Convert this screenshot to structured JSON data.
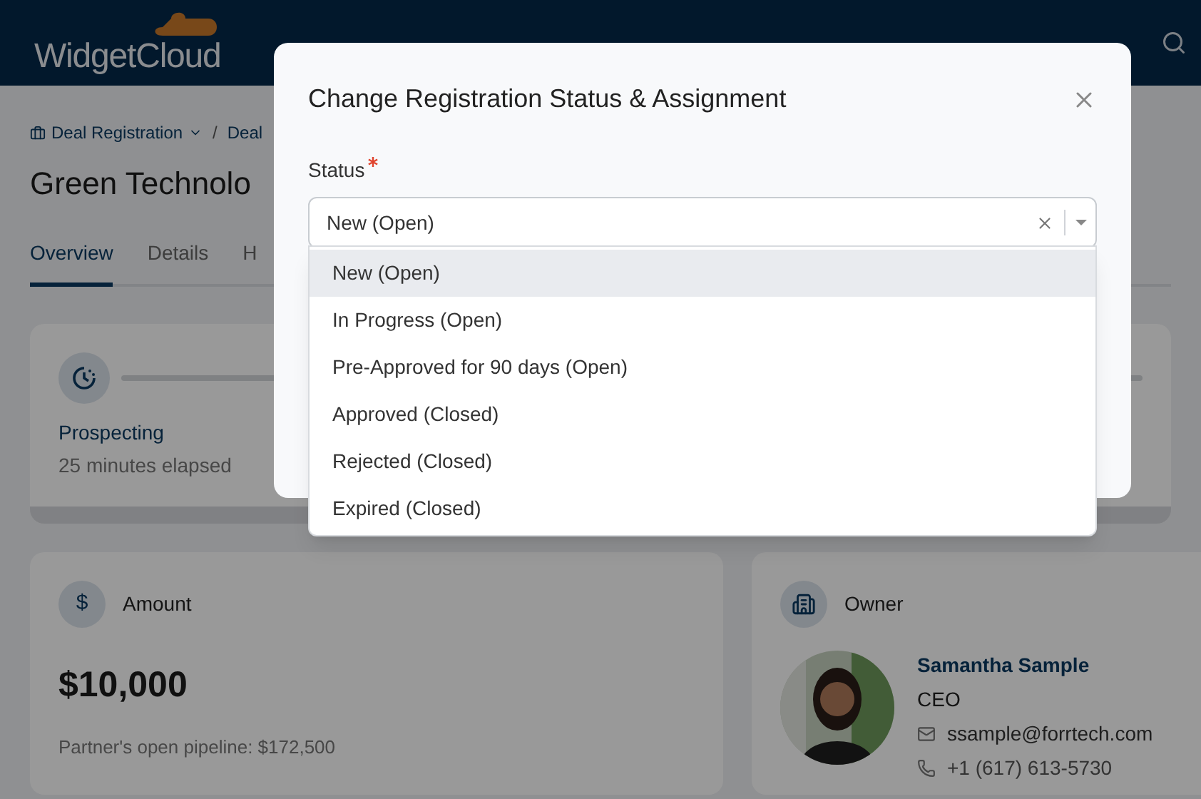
{
  "header": {
    "logo": "WidgetCloud"
  },
  "breadcrumb": {
    "items": [
      "Deal Registration",
      "Deal"
    ],
    "separator": "/"
  },
  "page_title": "Green Technolo",
  "tabs": [
    {
      "label": "Overview",
      "selected": true
    },
    {
      "label": "Details",
      "selected": false
    },
    {
      "label": "H",
      "selected": false
    }
  ],
  "stage_card": {
    "stage": "Prospecting",
    "elapsed": "25 minutes elapsed"
  },
  "amount_card": {
    "title": "Amount",
    "icon_text": "$",
    "value": "$10,000",
    "note": "Partner's open pipeline: $172,500"
  },
  "owner_card": {
    "title": "Owner",
    "name": "Samantha Sample",
    "role": "CEO",
    "email": "ssample@forrtech.com",
    "phone": "+1 (617) 613-5730"
  },
  "modal": {
    "title": "Change Registration Status & Assignment",
    "field_label": "Status",
    "required": true,
    "value": "New (Open)",
    "options": [
      {
        "label": "New (Open)",
        "selected": true
      },
      {
        "label": "In Progress (Open)",
        "selected": false
      },
      {
        "label": "Pre-Approved for 90 days (Open)",
        "selected": false
      },
      {
        "label": "Approved (Closed)",
        "selected": false
      },
      {
        "label": "Rejected (Closed)",
        "selected": false
      },
      {
        "label": "Expired (Closed)",
        "selected": false
      }
    ]
  }
}
